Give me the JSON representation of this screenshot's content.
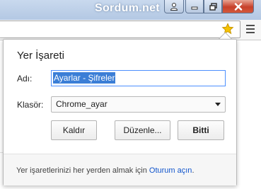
{
  "window": {
    "watermark": "Sordum.net",
    "controls": [
      "user-icon",
      "minimize-icon",
      "maximize-icon",
      "close-icon"
    ],
    "accent_color": "#4d90fe",
    "close_color": "#c7402a"
  },
  "toolbar": {
    "bookmark_star_color": "#f5c200",
    "icons": [
      "star-icon",
      "menu-icon"
    ]
  },
  "bookmark_bubble": {
    "title": "Yer İşareti",
    "name_label": "Adı:",
    "name_value": "Ayarlar - Şifreler",
    "folder_label": "Klasör:",
    "folder_value": "Chrome_ayar",
    "remove_button": "Kaldır",
    "edit_button": "Düzenle...",
    "done_button": "Bitti",
    "footer_text": "Yer işaretlerinizi her yerden almak için ",
    "footer_link": "Oturum açın",
    "footer_end": "."
  }
}
